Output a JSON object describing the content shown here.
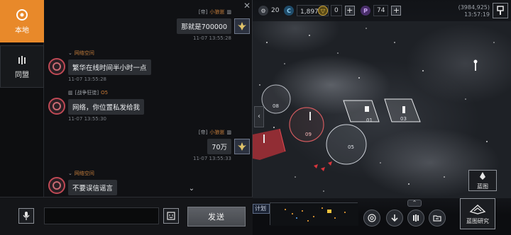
{
  "chat": {
    "tabs": [
      {
        "label": "本地",
        "active": true,
        "icon": "local-icon"
      },
      {
        "label": "同盟",
        "active": false,
        "icon": "alliance-icon"
      }
    ],
    "messages": [
      {
        "side": "right",
        "tag": "[帝]",
        "sender": "小狼崽",
        "text": "那就是700000",
        "time": "11-07 13:55:28"
      },
      {
        "side": "left",
        "sender": "网络空间",
        "text": "繁华在线时间半小时一点",
        "time": "11-07 13:55:28"
      },
      {
        "side": "left",
        "tag": "[战争狂徒]",
        "sender": "O5",
        "text": "网络，你位置私发给我",
        "time": "11-07 13:55:30"
      },
      {
        "side": "right",
        "tag": "[帝]",
        "sender": "小狼崽",
        "text": "70万",
        "time": "11-07 13:55:33"
      },
      {
        "side": "left",
        "sender": "网络空间",
        "text": "不要误信谣言",
        "time": ""
      }
    ],
    "input_placeholder": "",
    "send_label": "发送"
  },
  "resources": {
    "r1": "20",
    "r2": "1,897万",
    "r3": "0",
    "r4": "74"
  },
  "map": {
    "coordinates": "(3984,925)",
    "clock": "13:57:19",
    "labels": [
      "08",
      "09",
      "05",
      "01",
      "03"
    ],
    "plan_label": "计划",
    "blueprint_label": "蓝图",
    "blueprint_research_label": "蓝图研究"
  },
  "colors": {
    "accent": "#e8892a",
    "hostile": "#c0343a",
    "bubble": "#2c2f34"
  }
}
